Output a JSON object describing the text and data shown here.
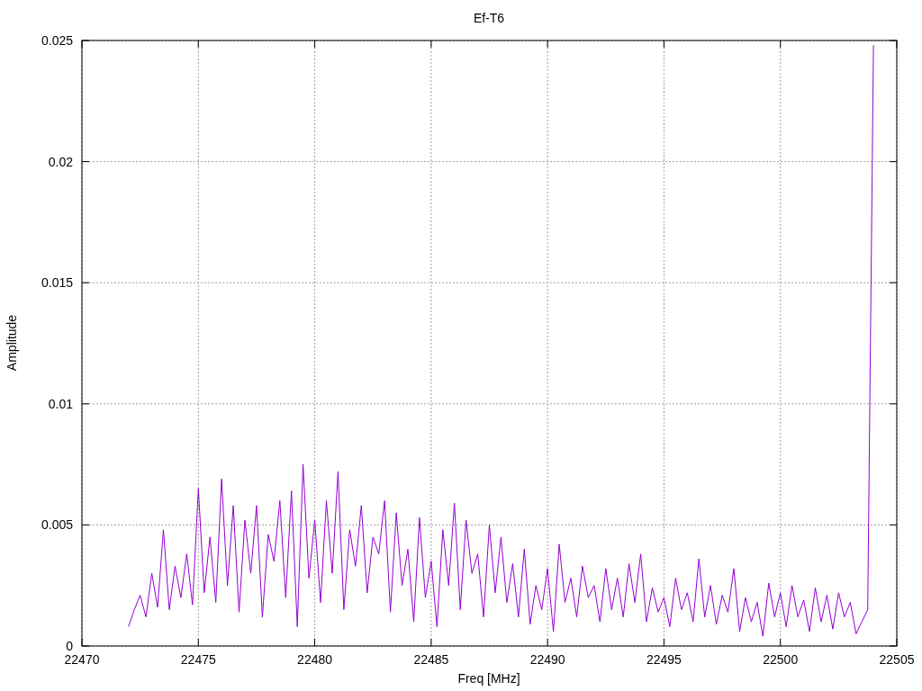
{
  "chart": {
    "chart_data": {
      "type": "line",
      "title": "Ef-T6",
      "xlabel": "Freq [MHz]",
      "ylabel": "Amplitude",
      "xlim": [
        22470,
        22505
      ],
      "grid": true,
      "ylim": [
        0,
        0.025
      ],
      "xticks": [
        22470,
        22475,
        22480,
        22485,
        22490,
        22495,
        22500,
        22505
      ],
      "yticks": [
        {
          "value": 0,
          "label": "0"
        },
        {
          "value": 0.005,
          "label": "0.005"
        },
        {
          "value": 0.01,
          "label": "0.01"
        },
        {
          "value": 0.015,
          "label": "0.015"
        },
        {
          "value": 0.02,
          "label": "0.02"
        },
        {
          "value": 0.025,
          "label": "0.025"
        }
      ],
      "x": [
        22472,
        22472.25,
        22472.5,
        22472.75,
        22473,
        22473.25,
        22473.5,
        22473.75,
        22474,
        22474.25,
        22474.5,
        22474.75,
        22475,
        22475.25,
        22475.5,
        22475.75,
        22476,
        22476.25,
        22476.5,
        22476.75,
        22477,
        22477.25,
        22477.5,
        22477.75,
        22478,
        22478.25,
        22478.5,
        22478.75,
        22479,
        22479.25,
        22479.5,
        22479.75,
        22480,
        22480.25,
        22480.5,
        22480.75,
        22481,
        22481.25,
        22481.5,
        22481.75,
        22482,
        22482.25,
        22482.5,
        22482.75,
        22483,
        22483.25,
        22483.5,
        22483.75,
        22484,
        22484.25,
        22484.5,
        22484.75,
        22485,
        22485.25,
        22485.5,
        22485.75,
        22486,
        22486.25,
        22486.5,
        22486.75,
        22487,
        22487.25,
        22487.5,
        22487.75,
        22488,
        22488.25,
        22488.5,
        22488.75,
        22489,
        22489.25,
        22489.5,
        22489.75,
        22490,
        22490.25,
        22490.5,
        22490.75,
        22491,
        22491.25,
        22491.5,
        22491.75,
        22492,
        22492.25,
        22492.5,
        22492.75,
        22493,
        22493.25,
        22493.5,
        22493.75,
        22494,
        22494.25,
        22494.5,
        22494.75,
        22495,
        22495.25,
        22495.5,
        22495.75,
        22496,
        22496.25,
        22496.5,
        22496.75,
        22497,
        22497.25,
        22497.5,
        22497.75,
        22498,
        22498.25,
        22498.5,
        22498.75,
        22499,
        22499.25,
        22499.5,
        22499.75,
        22500,
        22500.25,
        22500.5,
        22500.75,
        22501,
        22501.25,
        22501.5,
        22501.75,
        22502,
        22502.25,
        22502.5,
        22502.75,
        22503,
        22503.25,
        22503.5,
        22503.75,
        22504
      ],
      "series": [
        {
          "color": "#9400d3",
          "values": [
            0.0008,
            0.0015,
            0.0021,
            0.0012,
            0.003,
            0.0016,
            0.0048,
            0.0015,
            0.0033,
            0.002,
            0.0038,
            0.0017,
            0.0065,
            0.0022,
            0.0045,
            0.0018,
            0.0069,
            0.0025,
            0.0058,
            0.0014,
            0.0052,
            0.003,
            0.0058,
            0.0012,
            0.0046,
            0.0035,
            0.006,
            0.002,
            0.0064,
            0.0008,
            0.0075,
            0.0028,
            0.0052,
            0.0018,
            0.006,
            0.003,
            0.0072,
            0.0015,
            0.0048,
            0.0033,
            0.0058,
            0.0022,
            0.0045,
            0.0038,
            0.006,
            0.0014,
            0.0055,
            0.0025,
            0.004,
            0.001,
            0.0053,
            0.002,
            0.0035,
            0.0008,
            0.0048,
            0.0025,
            0.0059,
            0.0015,
            0.0052,
            0.003,
            0.0038,
            0.0012,
            0.005,
            0.0022,
            0.0045,
            0.0018,
            0.0034,
            0.0012,
            0.004,
            0.0009,
            0.0025,
            0.0015,
            0.0032,
            0.0006,
            0.0042,
            0.0018,
            0.0028,
            0.0012,
            0.0033,
            0.002,
            0.0025,
            0.001,
            0.0032,
            0.0015,
            0.0028,
            0.0012,
            0.0034,
            0.0018,
            0.0038,
            0.001,
            0.0024,
            0.0014,
            0.002,
            0.0008,
            0.0028,
            0.0015,
            0.0022,
            0.001,
            0.0036,
            0.0012,
            0.0025,
            0.0009,
            0.0021,
            0.0014,
            0.0032,
            0.0006,
            0.002,
            0.001,
            0.0018,
            0.0004,
            0.0026,
            0.0012,
            0.0022,
            0.0008,
            0.0025,
            0.0012,
            0.0019,
            0.0006,
            0.0024,
            0.001,
            0.0021,
            0.0007,
            0.0022,
            0.0012,
            0.0018,
            0.0005,
            0.001,
            0.0015,
            0.0248
          ]
        }
      ]
    }
  }
}
